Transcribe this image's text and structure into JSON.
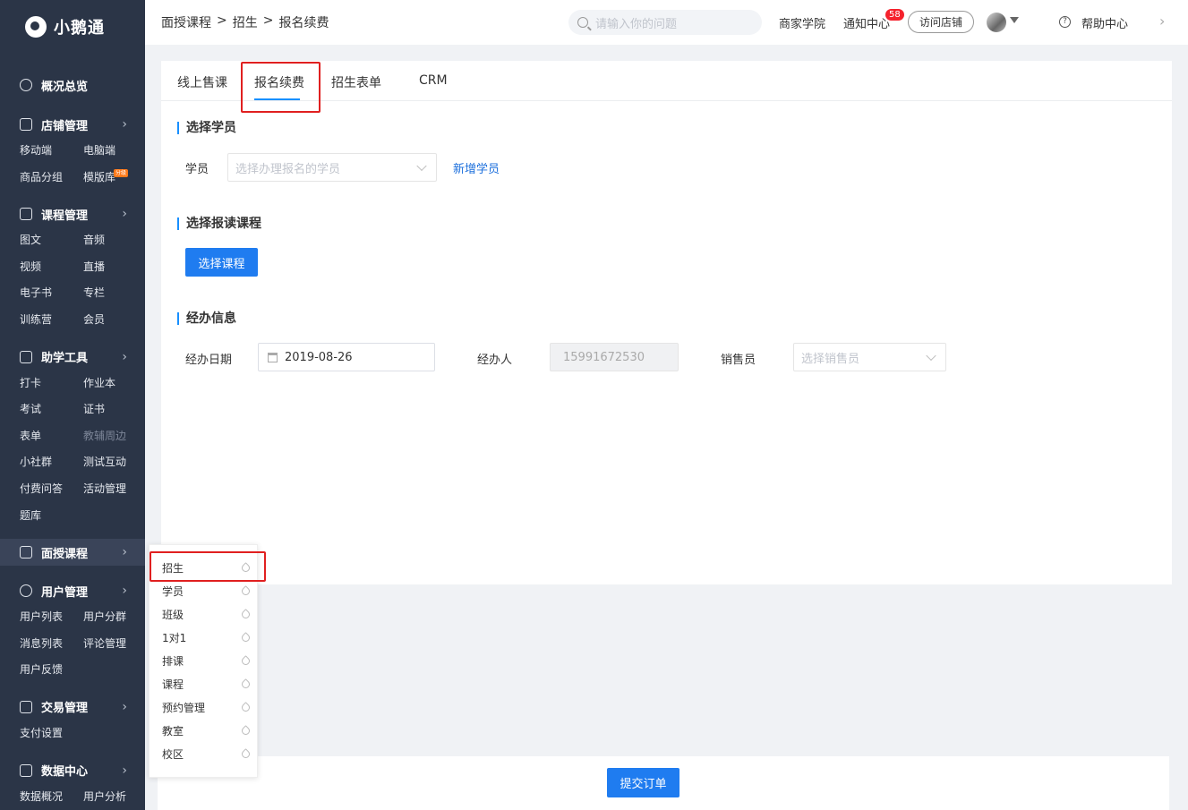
{
  "app": {
    "logo_text": "小鹅通"
  },
  "sidebar": {
    "overview": "概况总览",
    "groups": [
      {
        "title": "店铺管理",
        "items": [
          "移动端",
          "电脑端",
          "商品分组",
          "模版库"
        ]
      },
      {
        "title": "课程管理",
        "items": [
          "图文",
          "音频",
          "视频",
          "直播",
          "电子书",
          "专栏",
          "训练营",
          "会员"
        ]
      },
      {
        "title": "助学工具",
        "items": [
          "打卡",
          "作业本",
          "考试",
          "证书",
          "表单",
          "教辅周边",
          "小社群",
          "测试互动",
          "付费问答",
          "活动管理",
          "题库"
        ]
      },
      {
        "title": "面授课程"
      },
      {
        "title": "用户管理",
        "items": [
          "用户列表",
          "用户分群",
          "消息列表",
          "评论管理",
          "用户反馈"
        ]
      },
      {
        "title": "交易管理",
        "items": [
          "支付设置"
        ]
      },
      {
        "title": "数据中心",
        "items": [
          "数据概况",
          "用户分析"
        ]
      }
    ],
    "new_badge": "分级"
  },
  "header": {
    "breadcrumb": [
      "面授课程",
      ">",
      "招生",
      ">",
      "报名续费"
    ],
    "search_placeholder": "请输入你的问题",
    "merchant_academy": "商家学院",
    "notification_center": "通知中心",
    "notification_count": "58",
    "visit_store": "访问店铺",
    "help_center": "帮助中心"
  },
  "tabs": [
    "线上售课",
    "报名续费",
    "招生表单",
    "CRM"
  ],
  "form": {
    "section_student": "选择学员",
    "student_label": "学员",
    "student_placeholder": "选择办理报名的学员",
    "add_student": "新增学员",
    "section_course": "选择报读课程",
    "choose_course_btn": "选择课程",
    "section_handler": "经办信息",
    "date_label": "经办日期",
    "date_value": "2019-08-26",
    "handler_label": "经办人",
    "handler_value": "15991672530",
    "sales_label": "销售员",
    "sales_placeholder": "选择销售员"
  },
  "submit_btn": "提交订单",
  "flyout": [
    "招生",
    "学员",
    "班级",
    "1对1",
    "排课",
    "课程",
    "预约管理",
    "教室",
    "校区"
  ],
  "colors": {
    "sidebar_bg": "#2b3547",
    "primary": "#1f7cf0",
    "highlight": "#e02020"
  }
}
